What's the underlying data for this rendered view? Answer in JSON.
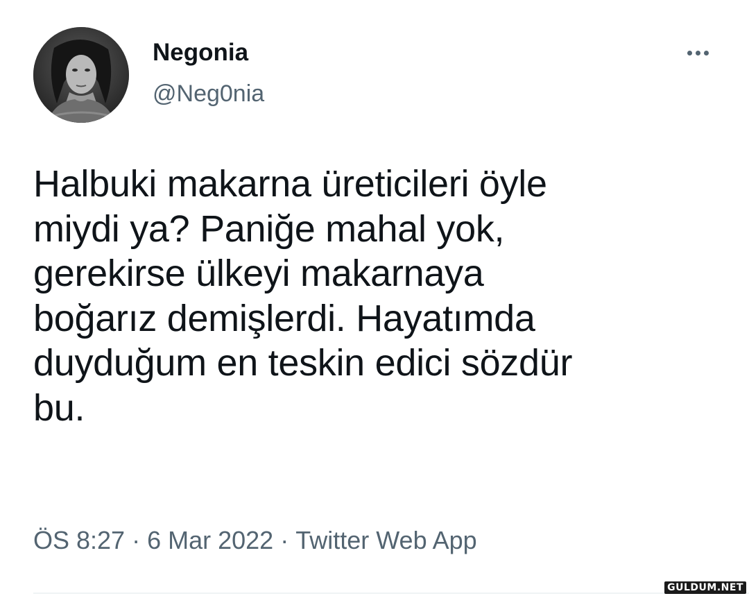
{
  "tweet": {
    "author": {
      "display_name": "Negonia",
      "handle": "@Neg0nia",
      "avatar_icon": "profile-photo"
    },
    "more_icon": "more-horizontal-icon",
    "text": "Halbuki makarna üreticileri öyle\nmiydi ya? Paniğe mahal yok,\ngerekirse ülkeyi makarnaya\nboğarız demişlerdi. Hayatımda\nduyduğum en teskin edici sözdür\nbu.",
    "meta": {
      "time": "ÖS 8:27",
      "separator": "·",
      "date": "6 Mar 2022",
      "source": "Twitter Web App"
    }
  },
  "watermark": "GULDUM.NET",
  "colors": {
    "text_primary": "#0f1419",
    "text_secondary": "#536471",
    "divider": "#eff3f4"
  }
}
